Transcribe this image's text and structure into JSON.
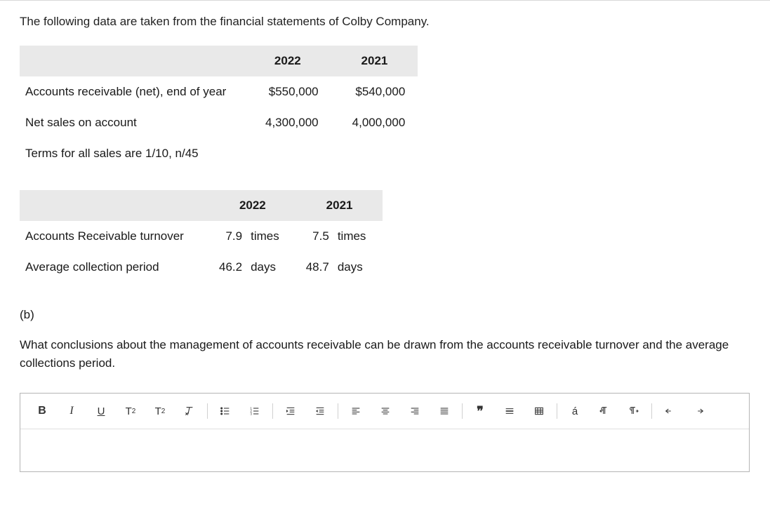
{
  "intro": "The following data are taken from the financial statements of Colby Company.",
  "table1": {
    "headers": [
      "",
      "2022",
      "2021"
    ],
    "rows": [
      {
        "label": "Accounts receivable (net), end of year",
        "y2022": "$550,000",
        "y2021": "$540,000"
      },
      {
        "label": "Net sales on account",
        "y2022": "4,300,000",
        "y2021": "4,000,000"
      },
      {
        "label": "Terms for all sales are 1/10, n/45",
        "y2022": "",
        "y2021": ""
      }
    ]
  },
  "table2": {
    "headers": [
      "",
      "2022",
      "2021"
    ],
    "rows": [
      {
        "label": "Accounts Receivable turnover",
        "v2022": "7.9",
        "u2022": "times",
        "v2021": "7.5",
        "u2021": "times"
      },
      {
        "label": "Average collection period",
        "v2022": "46.2",
        "u2022": "days",
        "v2021": "48.7",
        "u2021": "days"
      }
    ]
  },
  "part_label": "(b)",
  "question": "What conclusions about the management of accounts receivable can be drawn from the accounts receivable turnover and the average collections period.",
  "toolbar": {
    "bold": "B",
    "italic": "I",
    "underline": "U",
    "accent": "á",
    "quote": "❝"
  }
}
